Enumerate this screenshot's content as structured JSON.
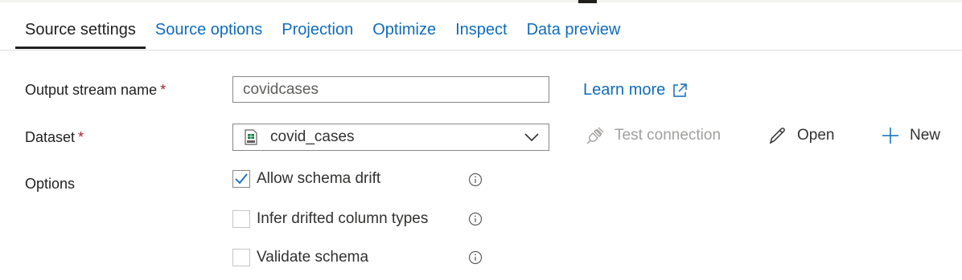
{
  "tabs": [
    {
      "label": "Source settings",
      "active": true
    },
    {
      "label": "Source options",
      "active": false
    },
    {
      "label": "Projection",
      "active": false
    },
    {
      "label": "Optimize",
      "active": false
    },
    {
      "label": "Inspect",
      "active": false
    },
    {
      "label": "Data preview",
      "active": false
    }
  ],
  "form": {
    "output_stream": {
      "label": "Output stream name",
      "required_mark": "*",
      "value": "covidcases"
    },
    "dataset": {
      "label": "Dataset",
      "required_mark": "*",
      "value": "covid_cases",
      "icon": "csv-file-icon"
    },
    "options": {
      "label": "Options"
    }
  },
  "learn_more": {
    "label": "Learn more",
    "icon": "external-link-icon"
  },
  "actions": {
    "test_connection": {
      "label": "Test connection",
      "disabled": true,
      "icon": "plug-icon"
    },
    "open": {
      "label": "Open",
      "icon": "pencil-icon"
    },
    "new": {
      "label": "New",
      "icon": "plus-icon"
    }
  },
  "checkboxes": [
    {
      "label": "Allow schema drift",
      "checked": true
    },
    {
      "label": "Infer drifted column types",
      "checked": false
    },
    {
      "label": "Validate schema",
      "checked": false
    }
  ],
  "colors": {
    "link": "#0f6cbd",
    "required": "#a4262c",
    "disabled": "#a19f9d",
    "text": "#201f1e"
  }
}
